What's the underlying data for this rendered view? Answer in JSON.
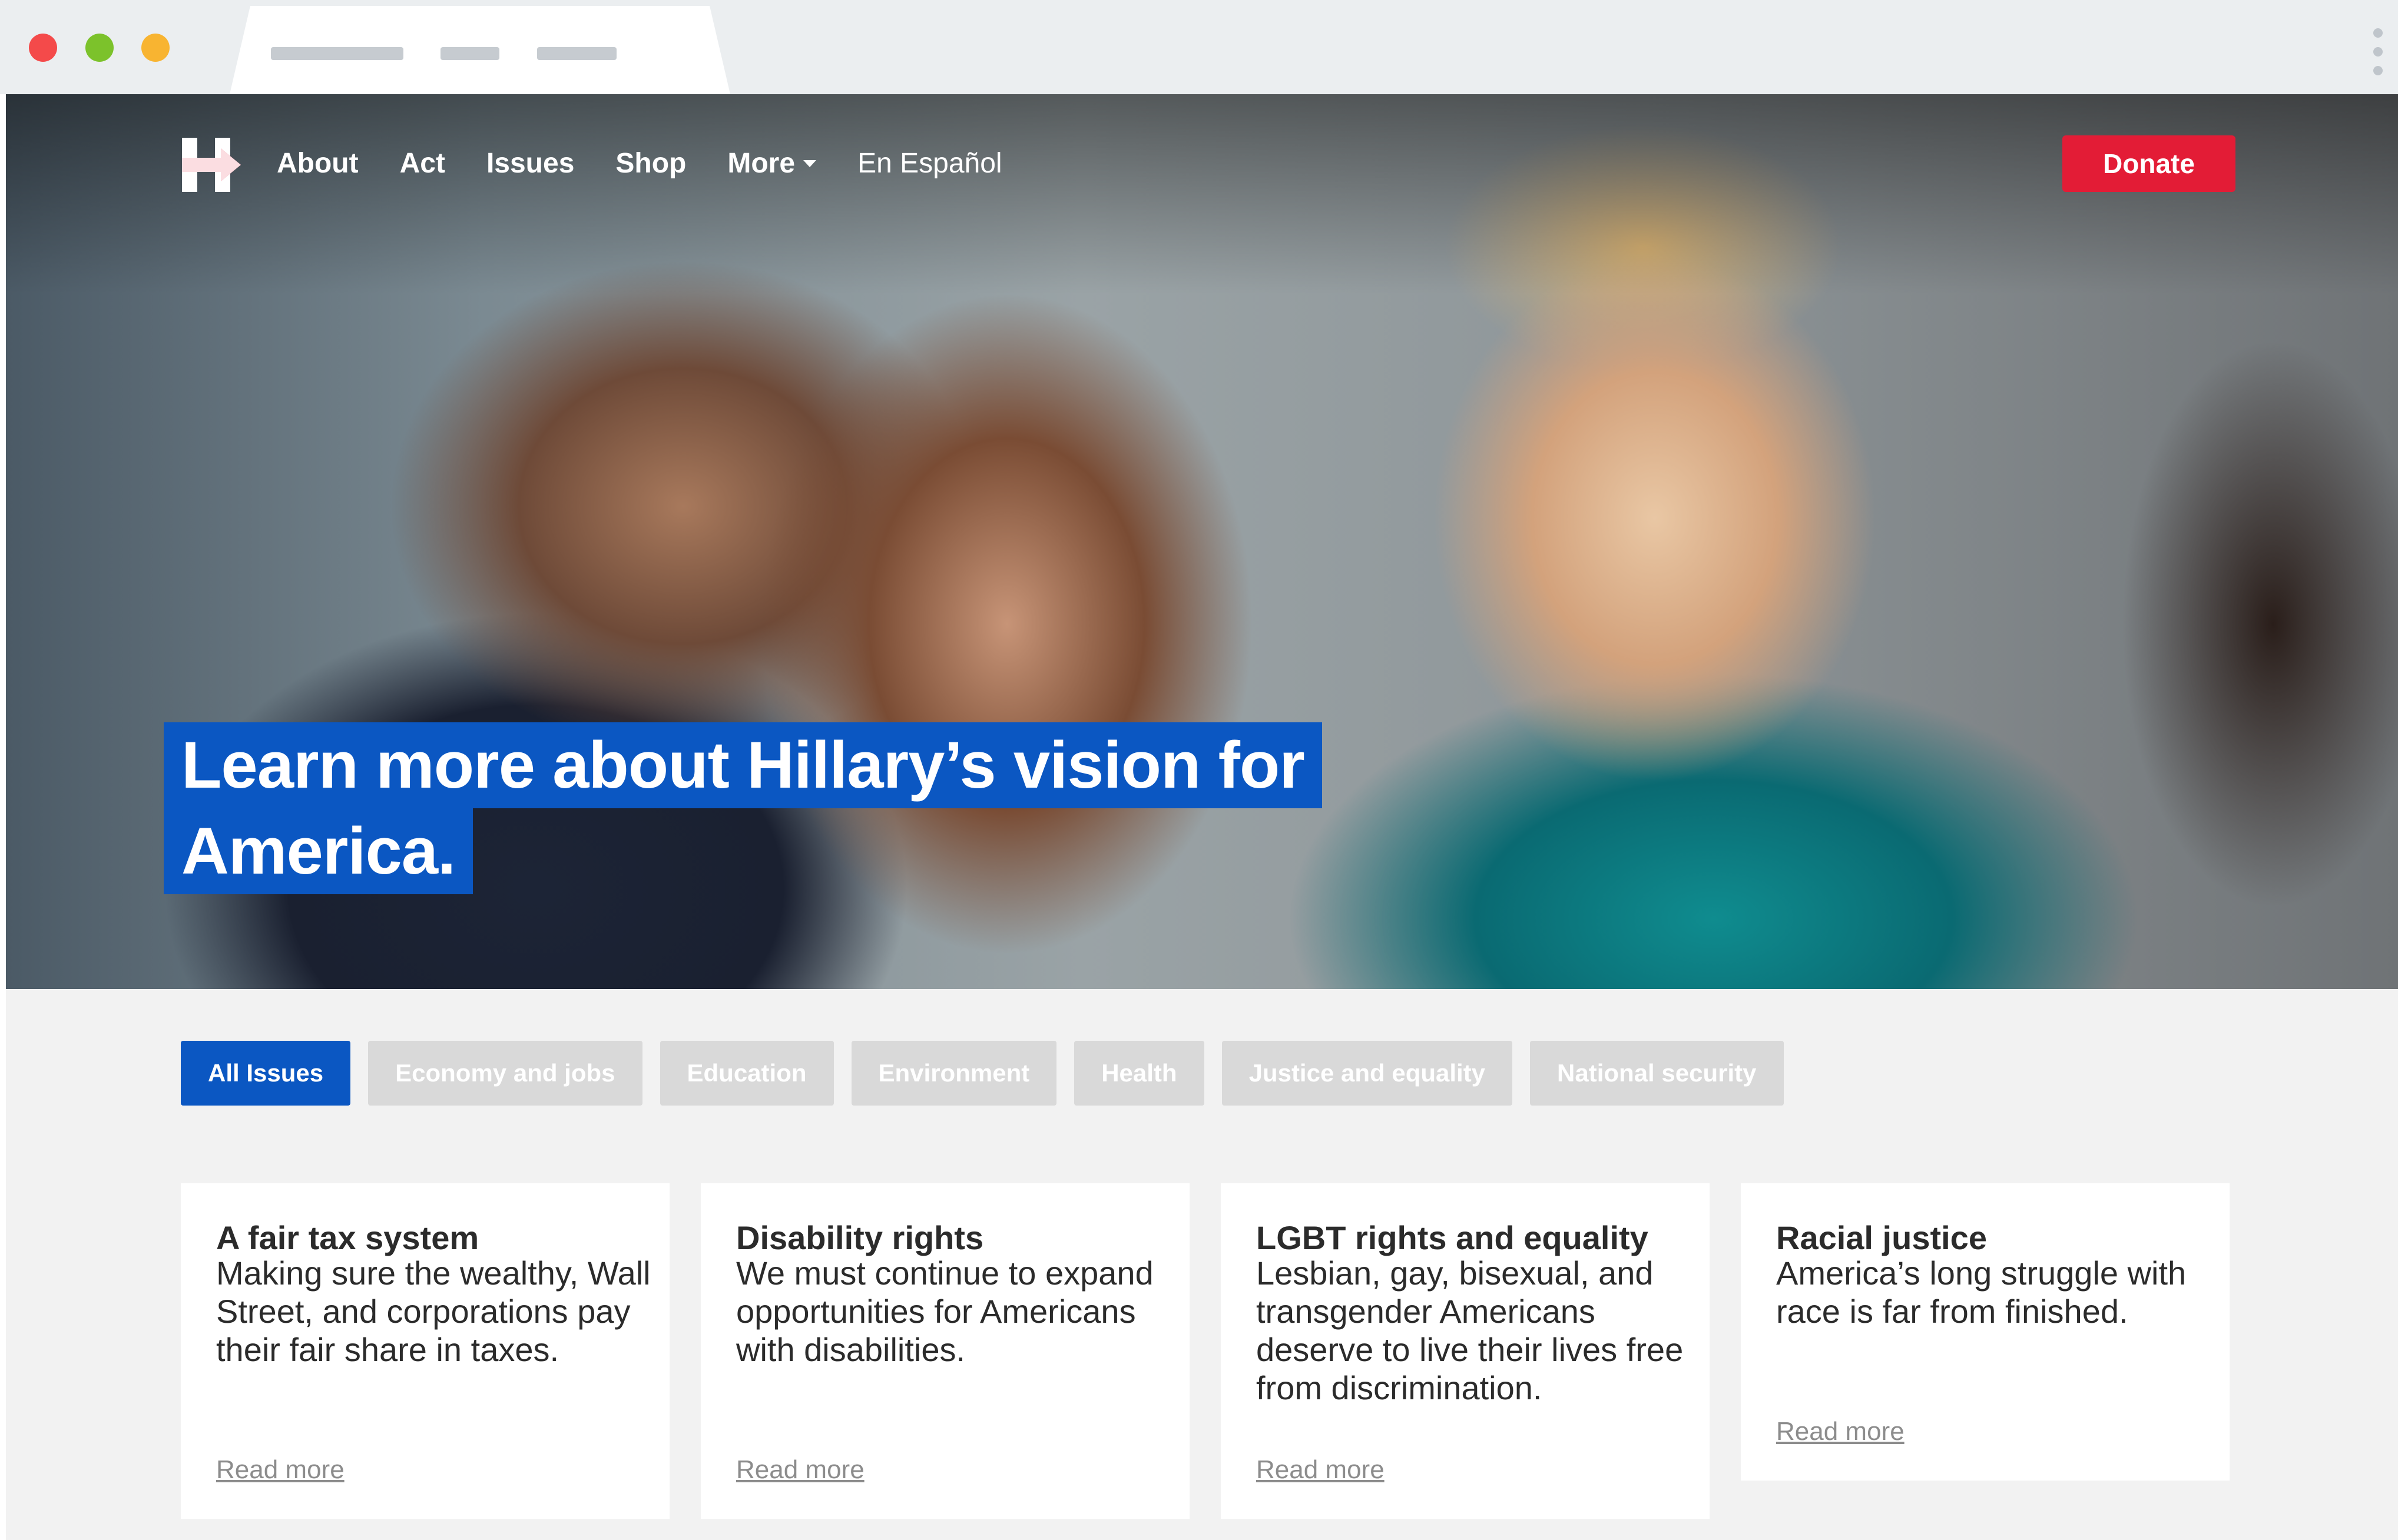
{
  "browser": {
    "colors": {
      "close": "#f44a4a",
      "minimize": "#7cc22b",
      "maximize": "#f8b431"
    }
  },
  "site": {
    "logo": "hillary-h-arrow-logo",
    "nav": [
      {
        "label": "About"
      },
      {
        "label": "Act"
      },
      {
        "label": "Issues"
      },
      {
        "label": "Shop"
      },
      {
        "label": "More"
      },
      {
        "label": "En Español"
      }
    ],
    "donate_label": "Donate",
    "colors": {
      "brand_blue": "#0b57c2",
      "donate_red": "#e31c36"
    }
  },
  "hero": {
    "headline_line1": "Learn more about Hillary’s vision for",
    "headline_line2": "America."
  },
  "filters": [
    {
      "label": "All Issues",
      "active": true
    },
    {
      "label": "Economy and jobs",
      "active": false
    },
    {
      "label": "Education",
      "active": false
    },
    {
      "label": "Environment",
      "active": false
    },
    {
      "label": "Health",
      "active": false
    },
    {
      "label": "Justice and equality",
      "active": false
    },
    {
      "label": "National security",
      "active": false
    }
  ],
  "cards": [
    {
      "title": "A fair tax system",
      "description": "Making sure the wealthy, Wall Street, and corporations pay their fair share in taxes.",
      "link": "Read more"
    },
    {
      "title": "Disability rights",
      "description": "We must continue to expand opportunities for Americans with disabilities.",
      "link": "Read more"
    },
    {
      "title": "LGBT rights and equality",
      "description": "Lesbian, gay, bisexual, and transgender Americans deserve to live their lives free from discrimination.",
      "link": "Read more"
    },
    {
      "title": "Racial justice",
      "description": "America’s long struggle with race is far from finished.",
      "link": "Read more"
    }
  ]
}
